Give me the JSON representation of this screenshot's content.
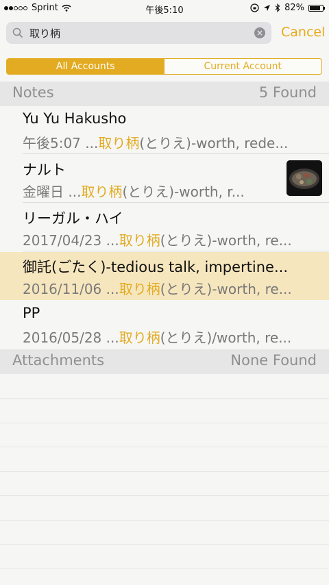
{
  "status": {
    "carrier": "Sprint",
    "time": "午後5:10",
    "battery": "82%",
    "battery_level": 0.82
  },
  "search": {
    "query": "取り柄",
    "cancel_label": "Cancel"
  },
  "scope": {
    "all_label": "All Accounts",
    "current_label": "Current Account"
  },
  "notes_section": {
    "label": "Notes",
    "count": "5 Found"
  },
  "notes": [
    {
      "title": "Yu Yu Hakusho",
      "date": "午後5:07",
      "prefix": "...",
      "hit": "取り柄",
      "rest": "(とりえ)-worth, rede..."
    },
    {
      "title": "ナルト",
      "date": "金曜日",
      "prefix": "...",
      "hit": "取り柄",
      "rest": "(とりえ)-worth, r..."
    },
    {
      "title": "リーガル・ハイ",
      "date": "2017/04/23",
      "prefix": "...",
      "hit": "取り柄",
      "rest": "(とりえ)-worth, re..."
    },
    {
      "title": "御託(ごたく)-tedious talk, impertine...",
      "date": "2016/11/06",
      "prefix": "...",
      "hit": "取り柄",
      "rest": "(とりえ)-worth, re..."
    },
    {
      "title": "PP",
      "date": "2016/05/28",
      "prefix": "...",
      "hit": "取り柄",
      "rest": "(とりえ)/worth, re..."
    }
  ],
  "attachments_section": {
    "label": "Attachments",
    "count": "None Found"
  },
  "colors": {
    "accent": "#e2ab21",
    "highlight": "#f6e6be"
  }
}
